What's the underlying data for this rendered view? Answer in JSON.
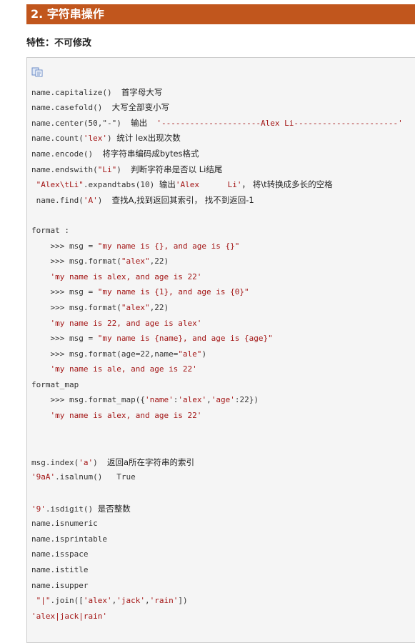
{
  "header": {
    "title": "2. 字符串操作"
  },
  "subtitle": "特性：不可修改",
  "toolbar": {
    "copy_icon": "copy-icon"
  },
  "colors": {
    "header_bg": "#c1561d",
    "string_red": "#a31515"
  },
  "code": {
    "l01_code": "name.capitalize()",
    "l01_note": "首字母大写",
    "l02_code": "name.casefold()",
    "l02_note": "大写全部变小写",
    "l03_code": "name.center(50,\"-\")",
    "l03_note": "输出",
    "l03_str": "'---------------------Alex Li----------------------'",
    "l04_code_a": "name.count(",
    "l04_str": "'lex'",
    "l04_code_b": ")",
    "l04_note": "统计 lex出现次数",
    "l05_code": "name.encode()",
    "l05_note": "将字符串编码成bytes格式",
    "l06_code_a": "name.endswith(",
    "l06_str": "\"Li\"",
    "l06_code_b": ")",
    "l06_note": "判断字符串是否以 Li结尾",
    "l07_str": "\"Alex\\tLi\"",
    "l07_code": ".expandtabs(10)",
    "l07_note_a": "输出",
    "l07_str2": "'Alex      Li'",
    "l07_note_b": "， 将\\t转换成多长的空格",
    "l08_code_a": "name.find(",
    "l08_str": "'A'",
    "l08_code_b": ")",
    "l08_note": "查找A,找到返回其索引， 找不到返回-1",
    "l09": "format :",
    "l10_code": ">>> msg = ",
    "l10_str": "\"my name is {}, and age is {}\"",
    "l11_code_a": ">>> msg.format(",
    "l11_str": "\"alex\"",
    "l11_code_b": ",22)",
    "l12_str": "'my name is alex, and age is 22'",
    "l13_code": ">>> msg = ",
    "l13_str": "\"my name is {1}, and age is {0}\"",
    "l14_code_a": ">>> msg.format(",
    "l14_str": "\"alex\"",
    "l14_code_b": ",22)",
    "l15_str": "'my name is 22, and age is alex'",
    "l16_code": ">>> msg = ",
    "l16_str": "\"my name is {name}, and age is {age}\"",
    "l17_code_a": ">>> msg.format(age=22,name=",
    "l17_str": "\"ale\"",
    "l17_code_b": ")",
    "l18_str": "'my name is ale, and age is 22'",
    "l19": "format_map",
    "l20_code_a": ">>> msg.format_map({",
    "l20_str1": "'name'",
    "l20_c1": ":",
    "l20_str2": "'alex'",
    "l20_c2": ",",
    "l20_str3": "'age'",
    "l20_code_b": ":22})",
    "l21_str": "'my name is alex, and age is 22'",
    "l22_code_a": "msg.index(",
    "l22_str": "'a'",
    "l22_code_b": ")",
    "l22_note": "返回a所在字符串的索引",
    "l23_str": "'9aA'",
    "l23_code": ".isalnum()",
    "l23_out": "True",
    "l24_str": "'9'",
    "l24_code": ".isdigit()",
    "l24_note": "是否整数",
    "l25": "name.isnumeric",
    "l26": "name.isprintable",
    "l27": "name.isspace",
    "l28": "name.istitle",
    "l29": "name.isupper",
    "l30_str": "\"|\"",
    "l30_code_a": ".join([",
    "l30_s1": "'alex'",
    "l30_c1": ",",
    "l30_s2": "'jack'",
    "l30_c2": ",",
    "l30_s3": "'rain'",
    "l30_code_b": "])",
    "l31_str": "'alex|jack|rain'"
  }
}
